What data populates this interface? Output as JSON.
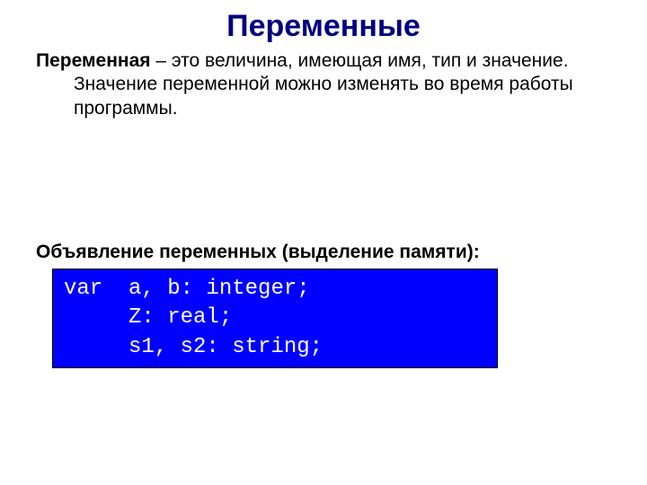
{
  "title": "Переменные",
  "definition": {
    "term": "Переменная",
    "rest": " – это величина, имеющая имя, тип и значение. Значение переменной можно изменять во время работы программы."
  },
  "subheading": "Объявление переменных (выделение памяти):",
  "code": {
    "line1": "var  a, b: integer;",
    "line2": "     Z: real;",
    "line3": "     s1, s2: string;"
  }
}
